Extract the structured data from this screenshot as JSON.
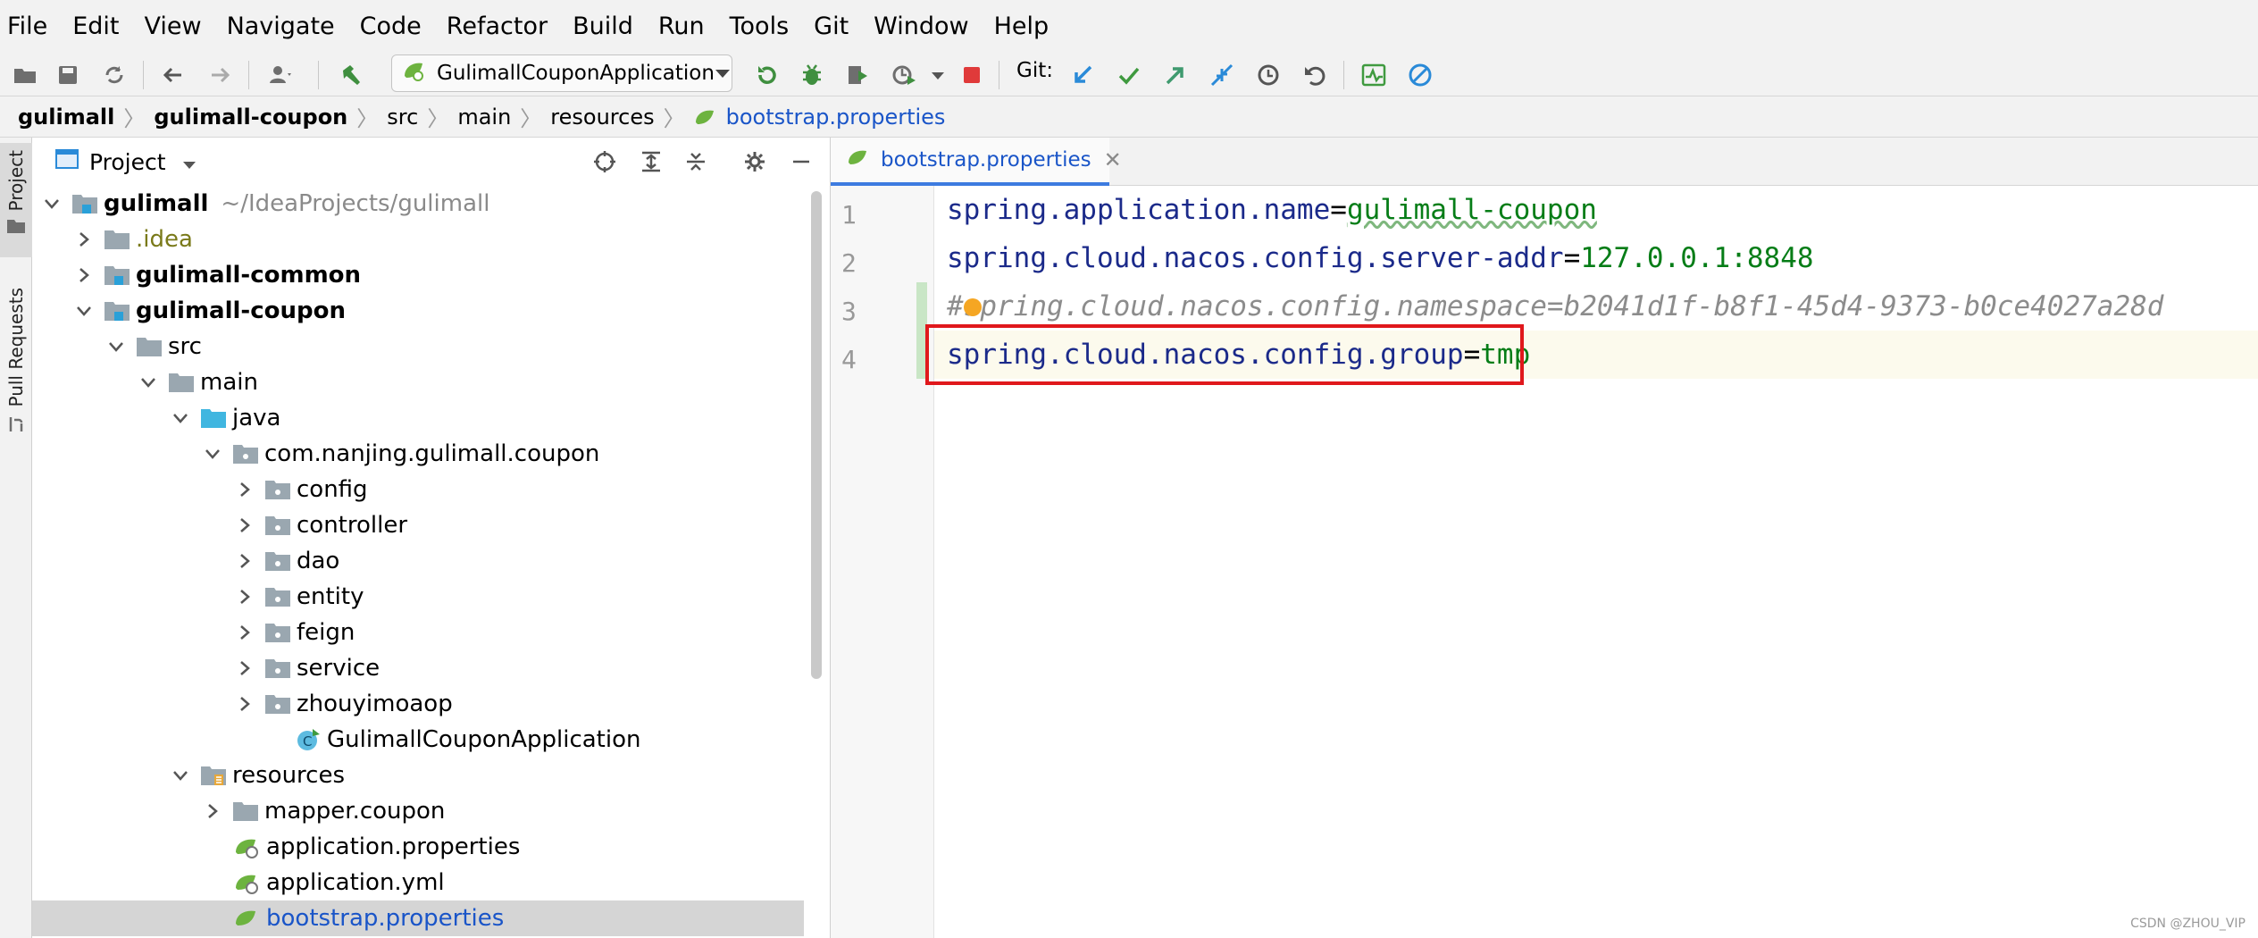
{
  "menu": [
    "File",
    "Edit",
    "View",
    "Navigate",
    "Code",
    "Refactor",
    "Build",
    "Run",
    "Tools",
    "Git",
    "Window",
    "Help"
  ],
  "toolbar": {
    "run_config": "GulimallCouponApplication",
    "git_label": "Git:"
  },
  "breadcrumb": {
    "items": [
      "gulimall",
      "gulimall-coupon",
      "src",
      "main",
      "resources",
      "bootstrap.properties"
    ]
  },
  "side_strip": {
    "project_tab": "Project",
    "pull_requests_tab": "Pull Requests"
  },
  "project_panel": {
    "title": "Project",
    "tree": [
      {
        "label": "gulimall",
        "path": "~/IdeaProjects/gulimall"
      },
      {
        "label": ".idea"
      },
      {
        "label": "gulimall-common"
      },
      {
        "label": "gulimall-coupon"
      },
      {
        "label": "src"
      },
      {
        "label": "main"
      },
      {
        "label": "java"
      },
      {
        "label": "com.nanjing.gulimall.coupon"
      },
      {
        "label": "config"
      },
      {
        "label": "controller"
      },
      {
        "label": "dao"
      },
      {
        "label": "entity"
      },
      {
        "label": "feign"
      },
      {
        "label": "service"
      },
      {
        "label": "zhouyimoaop"
      },
      {
        "label": "GulimallCouponApplication"
      },
      {
        "label": "resources"
      },
      {
        "label": "mapper.coupon"
      },
      {
        "label": "application.properties"
      },
      {
        "label": "application.yml"
      },
      {
        "label": "bootstrap.properties"
      }
    ]
  },
  "editor": {
    "tab_label": "bootstrap.properties",
    "lines": [
      {
        "number": "1",
        "key": "spring.application.name",
        "sep": "=",
        "value": "gulimall-coupon"
      },
      {
        "number": "2",
        "key": "spring.cloud.nacos.config.server-addr",
        "sep": "=",
        "value": "127.0.0.1:8848"
      },
      {
        "number": "3",
        "comment": "#spring.cloud.nacos.config.namespace=b2041d1f-b8f1-45d4-9373-b0ce4027a28d"
      },
      {
        "number": "4",
        "key": "spring.cloud.nacos.config.group",
        "sep": "=",
        "value": "tmp"
      }
    ]
  },
  "watermark": "CSDN @ZHOU_VIP",
  "colors": {
    "highlight_box": "#e0181c",
    "accent": "#3d7be0",
    "key": "#1b2a8a",
    "value": "#067d17"
  }
}
